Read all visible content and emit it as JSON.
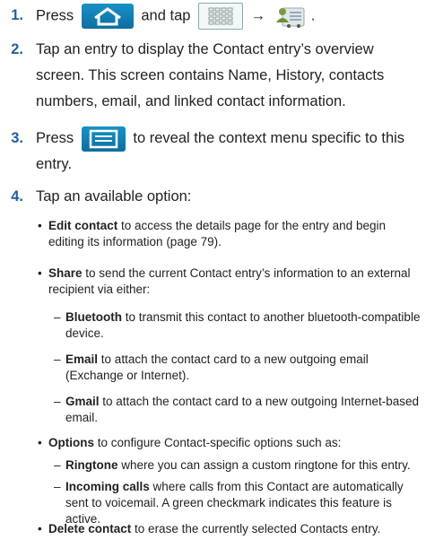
{
  "steps": [
    {
      "num": "1.",
      "pre": "Press",
      "mid": "and tap",
      "arrow": "→",
      "end": "."
    },
    {
      "num": "2.",
      "text": "Tap an entry to display the Contact entry’s overview screen. This screen contains Name, History, contacts numbers, email, and linked contact information."
    },
    {
      "num": "3.",
      "pre": "Press",
      "post": "to reveal the context menu specific to this entry."
    },
    {
      "num": "4.",
      "text": "Tap an available option:"
    }
  ],
  "options": [
    {
      "label": "Edit contact",
      "text": "to access the details page for the entry and begin editing its information (page 79)."
    },
    {
      "label": "Share",
      "text": "to send the current Contact entry’s information to an external recipient via either:"
    },
    {
      "label": "Options",
      "text": "to configure Contact-specific options such as:"
    },
    {
      "label": "Delete contact",
      "text": "to erase the currently selected Contacts entry."
    }
  ],
  "share_methods": [
    {
      "label": "Bluetooth",
      "text": "to transmit this contact to another bluetooth-compatible device."
    },
    {
      "label": "Email",
      "text": "to attach the contact card to a new outgoing email (Exchange or Internet)."
    },
    {
      "label": "Gmail",
      "text": "to attach the contact card to a new outgoing Internet-based email."
    }
  ],
  "option_settings": [
    {
      "label": "Ringtone",
      "text": "where you can assign a custom ringtone for this entry."
    },
    {
      "label": "Incoming calls",
      "text": "where calls from this Contact are automatically sent to voicemail. A green checkmark indicates this feature is active."
    }
  ],
  "icons": [
    "home-icon",
    "applications-icon",
    "contacts-icon",
    "menu-icon"
  ],
  "colors": {
    "step_number": "#1f5fa8",
    "button_blue": "#1186bd"
  }
}
